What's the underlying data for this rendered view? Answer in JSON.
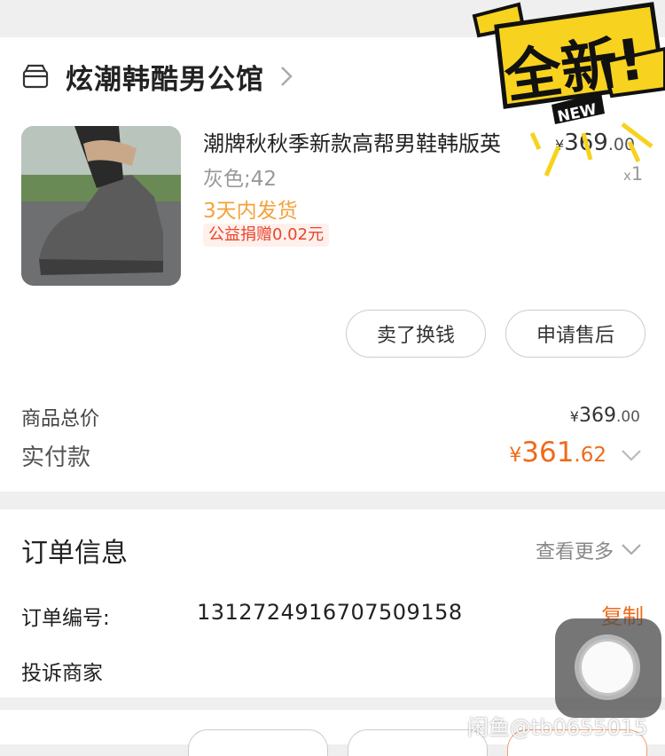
{
  "shop": {
    "name": "炫潮韩酷男公馆",
    "icon": "store-icon"
  },
  "product": {
    "title": "潮牌秋秋季新款高帮男鞋韩版英",
    "price_currency": "¥",
    "price_int": "369",
    "price_dec": ".00",
    "spec": "灰色;42",
    "qty_prefix": "x",
    "qty": "1",
    "shipping": "3天内发货",
    "charity": "公益捐赠0.02元"
  },
  "actions": {
    "sell": "卖了换钱",
    "after_sale": "申请售后"
  },
  "totals": {
    "goods_label": "商品总价",
    "goods_currency": "¥",
    "goods_int": "369",
    "goods_dec": ".00",
    "paid_label": "实付款",
    "paid_currency": "¥",
    "paid_int": "361",
    "paid_dec": ".62"
  },
  "order_info": {
    "title": "订单信息",
    "more": "查看更多",
    "order_no_label": "订单编号:",
    "order_no": "1312724916707509158",
    "copy": "复制",
    "complain": "投诉商家"
  },
  "sticker": {
    "main": "全新!",
    "badge": "NEW"
  },
  "watermark": "闲鱼@tb0655015",
  "colors": {
    "accent": "#ef6a1a",
    "shipping": "#f5a23a",
    "charity": "#e8452c",
    "sticker_yellow": "#f7d21e"
  }
}
